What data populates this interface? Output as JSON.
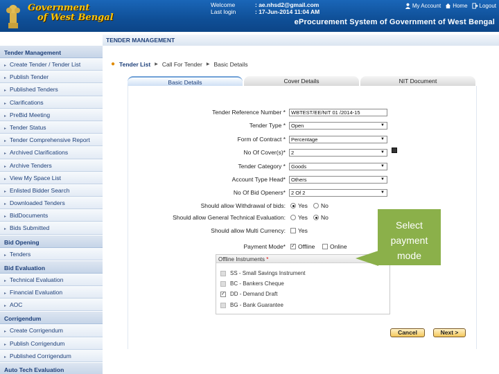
{
  "header": {
    "brand_line1": "Government",
    "brand_line2": "of West Bengal",
    "welcome_label": "Welcome",
    "welcome_value": ": ae.nhsd2@gmail.com",
    "last_login_label": "Last login",
    "last_login_value": ": 17-Jun-2014 11:04 AM",
    "my_account": "My Account",
    "home": "Home",
    "logout": "Logout",
    "system_title": "eProcurement System of Government of West Bengal"
  },
  "sidebar": {
    "items": [
      {
        "type": "head",
        "label": "Tender Management"
      },
      {
        "type": "item",
        "label": "Create Tender / Tender List"
      },
      {
        "type": "item",
        "label": "Publish Tender"
      },
      {
        "type": "item",
        "label": "Published Tenders"
      },
      {
        "type": "item",
        "label": "Clarifications"
      },
      {
        "type": "item",
        "label": "PreBid Meeting"
      },
      {
        "type": "item",
        "label": "Tender Status"
      },
      {
        "type": "item",
        "label": "Tender Comprehensive Report"
      },
      {
        "type": "item",
        "label": "Archived Clarifications"
      },
      {
        "type": "item",
        "label": "Archive Tenders"
      },
      {
        "type": "item",
        "label": "View My Space List"
      },
      {
        "type": "item",
        "label": "Enlisted Bidder Search"
      },
      {
        "type": "item",
        "label": "Downloaded Tenders"
      },
      {
        "type": "item",
        "label": "BidDocuments"
      },
      {
        "type": "item",
        "label": "Bids Submitted"
      },
      {
        "type": "head",
        "label": "Bid Opening"
      },
      {
        "type": "item",
        "label": "Tenders"
      },
      {
        "type": "head",
        "label": "Bid Evaluation"
      },
      {
        "type": "item",
        "label": "Technical Evaluation"
      },
      {
        "type": "item",
        "label": "Financial Evaluation"
      },
      {
        "type": "item",
        "label": "AOC"
      },
      {
        "type": "head",
        "label": "Corrigendum"
      },
      {
        "type": "item",
        "label": "Create Corrigendum"
      },
      {
        "type": "item",
        "label": "Publish Corrigendum"
      },
      {
        "type": "item",
        "label": "Published Corrigendum"
      },
      {
        "type": "head",
        "label": "Auto Tech Evaluation"
      }
    ]
  },
  "main": {
    "section_title": "TENDER MANAGEMENT",
    "breadcrumb": [
      "Tender List",
      "Call For Tender",
      "Basic Details"
    ],
    "tabs": [
      "Basic Details",
      "Cover Details",
      "NIT Document"
    ]
  },
  "form": {
    "tender_ref": {
      "label": "Tender Reference Number *",
      "value": "WBTEST/EE/NIT 01 /2014-15"
    },
    "tender_type": {
      "label": "Tender Type *",
      "value": "Open"
    },
    "form_of_contract": {
      "label": "Form of Contract *",
      "value": "Percentage"
    },
    "no_of_covers": {
      "label": "No Of Cover(s)*",
      "value": "2"
    },
    "tender_category": {
      "label": "Tender Category *",
      "value": "Goods"
    },
    "account_type_head": {
      "label": "Account Type Head*",
      "value": "Others"
    },
    "bid_openers": {
      "label": "No Of Bid Openers*",
      "value": "2 Of 2"
    },
    "withdrawal": {
      "label": "Should allow Withdrawal of bids:",
      "yes": "Yes",
      "no": "No",
      "selected": "Yes"
    },
    "general_tech_eval": {
      "label": "Should allow General Technical Evaluation:",
      "yes": "Yes",
      "no": "No",
      "selected": "No"
    },
    "multi_currency": {
      "label": "Should allow Multi Currency:",
      "yes": "Yes",
      "checked": false
    },
    "payment_mode": {
      "label": "Payment Mode*",
      "offline": "Offline",
      "online": "Online",
      "offline_checked": true,
      "online_checked": false
    },
    "offline_instruments": {
      "title": "Offline Instruments",
      "items": [
        {
          "label": "SS - Small Savings Instrument",
          "checked": false
        },
        {
          "label": "BC - Bankers Cheque",
          "checked": false
        },
        {
          "label": "DD - Demand Draft",
          "checked": true
        },
        {
          "label": "BG - Bank Guarantee",
          "checked": false
        }
      ]
    },
    "cancel_label": "Cancel",
    "next_label": "Next >"
  },
  "callout": {
    "line1": "Select",
    "line2": "payment",
    "line3": "mode",
    "color": "#8bb04a"
  }
}
